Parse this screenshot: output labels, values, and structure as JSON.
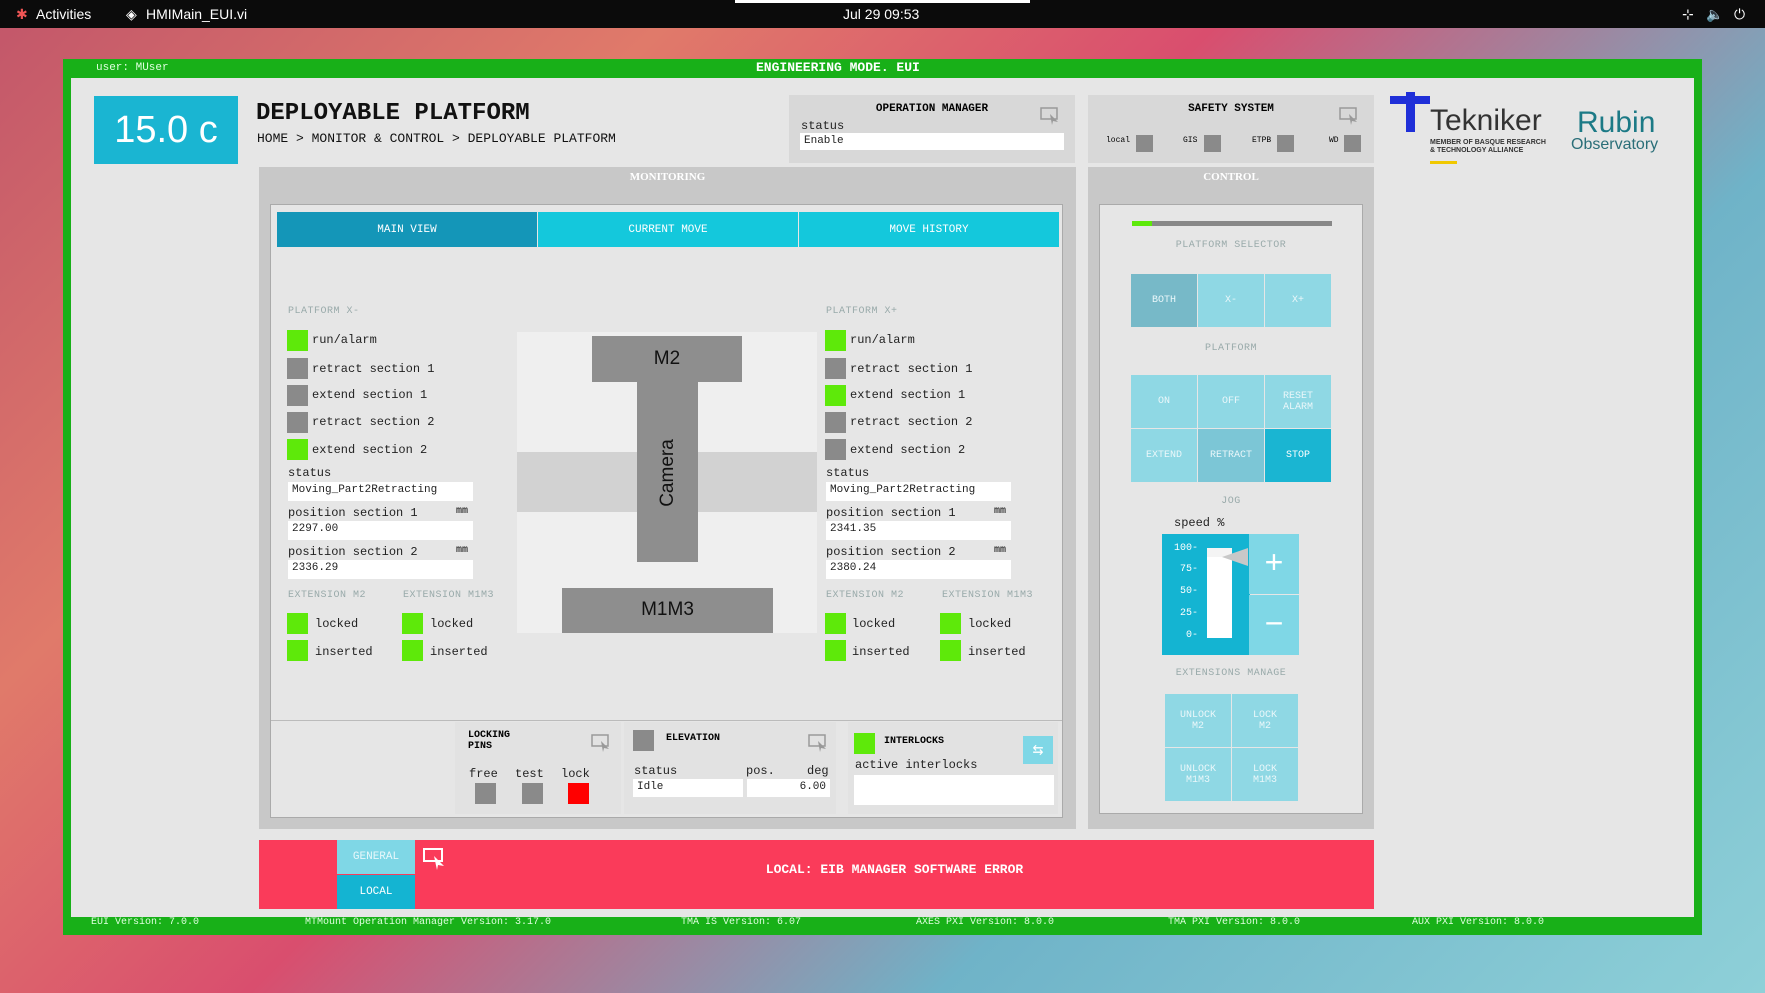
{
  "topbar": {
    "activities": "Activities",
    "app": "HMIMain_EUI.vi",
    "clock": "Jul 29  09:53"
  },
  "header": {
    "user": "user: MUser",
    "mode": "ENGINEERING MODE. EUI"
  },
  "temperature": "15.0 c",
  "page": {
    "title": "DEPLOYABLE PLATFORM",
    "breadcrumb": "HOME > MONITOR & CONTROL > DEPLOYABLE PLATFORM"
  },
  "operation_manager": {
    "title": "OPERATION MANAGER",
    "status_label": "status",
    "status": "Enable"
  },
  "safety": {
    "title": "SAFETY SYSTEM",
    "items": [
      "local",
      "GIS",
      "ETPB",
      "WD"
    ]
  },
  "logos": {
    "tekniker": "Tekniker",
    "tekniker_sub1": "MEMBER OF BASQUE RESEARCH",
    "tekniker_sub2": "& TECHNOLOGY ALLIANCE",
    "rubin": "Rubin",
    "observatory": "Observatory"
  },
  "monitoring": {
    "title": "MONITORING",
    "tabs": [
      "MAIN VIEW",
      "CURRENT MOVE",
      "MOVE HISTORY"
    ]
  },
  "platform_minus": {
    "title": "PLATFORM X-",
    "signals": [
      {
        "label": "run/alarm",
        "state": "green"
      },
      {
        "label": "retract section 1",
        "state": "gray"
      },
      {
        "label": "extend section 1",
        "state": "gray"
      },
      {
        "label": "retract section 2",
        "state": "gray"
      },
      {
        "label": "extend section 2",
        "state": "green"
      }
    ],
    "status_label": "status",
    "status": "Moving_Part2Retracting",
    "pos1_label": "position section 1",
    "pos1": "2297.00",
    "pos2_label": "position section 2",
    "pos2": "2336.29",
    "unit": "mm",
    "ext_m2": "EXTENSION M2",
    "ext_m1m3": "EXTENSION M1M3",
    "locked": "locked",
    "inserted": "inserted"
  },
  "platform_plus": {
    "title": "PLATFORM X+",
    "signals": [
      {
        "label": "run/alarm",
        "state": "green"
      },
      {
        "label": "retract section 1",
        "state": "gray"
      },
      {
        "label": "extend section 1",
        "state": "green"
      },
      {
        "label": "retract section 2",
        "state": "gray"
      },
      {
        "label": "extend section 2",
        "state": "gray"
      }
    ],
    "status_label": "status",
    "status": "Moving_Part2Retracting",
    "pos1_label": "position section 1",
    "pos1": "2341.35",
    "pos2_label": "position section 2",
    "pos2": "2380.24",
    "unit": "mm",
    "ext_m2": "EXTENSION M2",
    "ext_m1m3": "EXTENSION M1M3",
    "locked": "locked",
    "inserted": "inserted"
  },
  "diagram": {
    "m2": "M2",
    "camera": "Camera",
    "m1m3": "M1M3"
  },
  "locking_pins": {
    "title1": "LOCKING",
    "title2": "PINS",
    "free": "free",
    "test": "test",
    "lock": "lock"
  },
  "elevation": {
    "title": "ELEVATION",
    "status_label": "status",
    "status": "Idle",
    "pos_label": "pos.",
    "unit": "deg",
    "pos": "6.00"
  },
  "interlocks": {
    "title": "INTERLOCKS",
    "active_label": "active interlocks",
    "active": ""
  },
  "control": {
    "title": "CONTROL",
    "selector_label": "PLATFORM SELECTOR",
    "selector": [
      "BOTH",
      "X-",
      "X+"
    ],
    "platform_label": "PLATFORM",
    "on": "ON",
    "off": "OFF",
    "reset1": "RESET",
    "reset2": "ALARM",
    "extend": "EXTEND",
    "retract": "RETRACT",
    "stop": "STOP",
    "jog_label": "JOG",
    "speed_label": "speed %",
    "ticks": [
      "100-",
      "75-",
      "50-",
      "25-",
      "0-"
    ],
    "speed_level": 0.9,
    "ext_manage": "EXTENSIONS MANAGE",
    "unlock": "UNLOCK",
    "lock": "LOCK",
    "m2": "M2",
    "m1m3": "M1M3"
  },
  "alarm": {
    "general": "GENERAL",
    "local": "LOCAL",
    "message": "LOCAL: EIB MANAGER SOFTWARE ERROR"
  },
  "footer": [
    "EUI Version: 7.0.0",
    "MTMount Operation Manager Version: 3.17.0",
    "TMA IS Version: 6.07",
    "AXES PXI Version: 8.0.0",
    "TMA PXI Version: 8.0.0",
    "AUX PXI Version: 8.0.0"
  ]
}
